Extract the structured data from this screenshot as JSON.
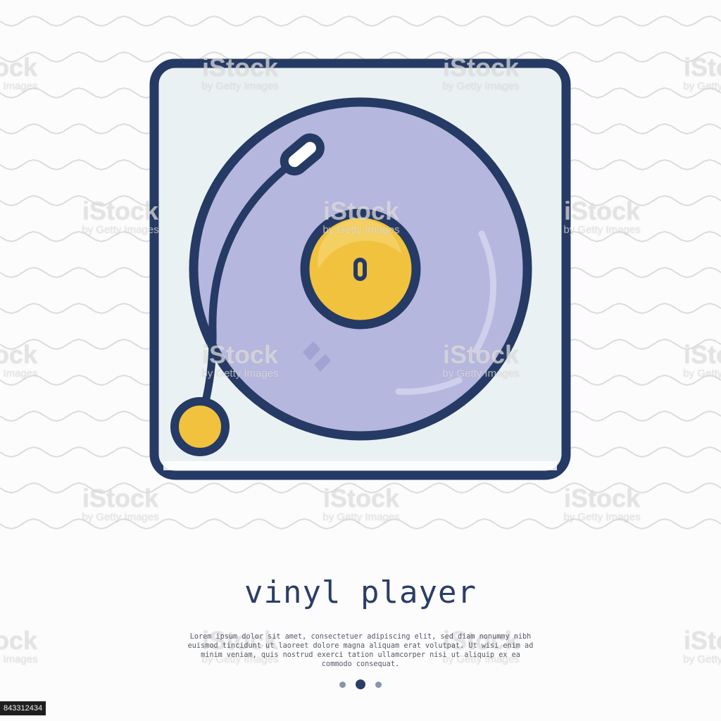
{
  "illustration": {
    "title": "vinyl player",
    "description": "Lorem ipsum dolor sit amet, consectetuer adipiscing elit, sed diam nonummy nibh euismod tincidunt ut laoreet dolore magna aliquam erat volutpat. Ut wisi enim ad minim veniam, quis nostrud exerci tation ullamcorper nisi ut aliquip ex ea commodo consequat.",
    "icon_name": "turntable-icon",
    "pagination": {
      "count": 3,
      "active_index": 2
    }
  },
  "watermark": {
    "brand": "iStock",
    "credit": "by Getty Images"
  },
  "stock_id": "843312434",
  "colors": {
    "outline": "#253a64",
    "title_text": "#2b3e66",
    "body_text": "#555a66",
    "background": "#fcfcfd",
    "wave_lines": "#dcdcdf",
    "frame_fill": "#eaf1f3",
    "record_fill": "#b6b7de",
    "label_fill": "#f0c23e",
    "stock_id_text": "#f2f2f2",
    "dot_color": "#2b3e66"
  }
}
